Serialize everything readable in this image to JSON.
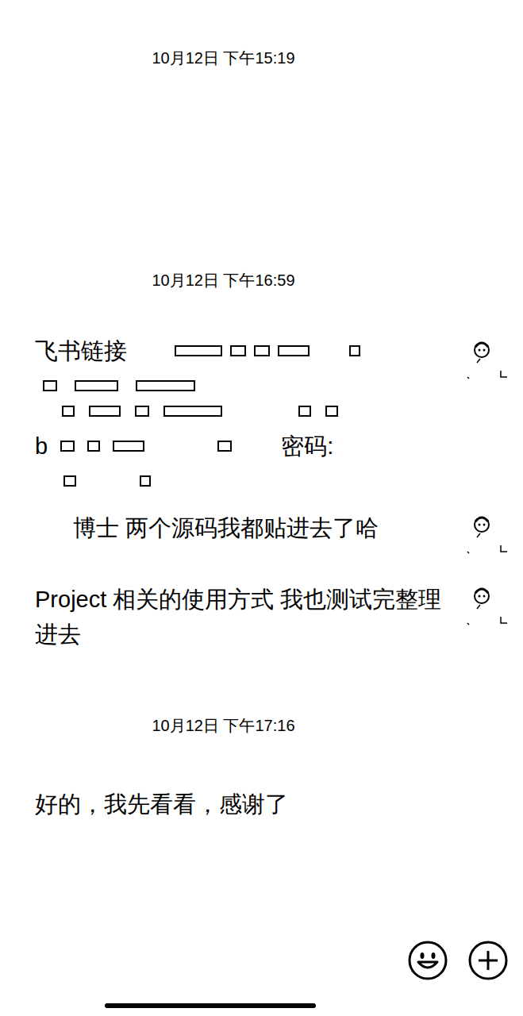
{
  "chat": {
    "items": [
      {
        "kind": "timestamp",
        "text": "10月12日 下午15:19"
      },
      {
        "kind": "blank"
      },
      {
        "kind": "timestamp",
        "text": "10月12日 下午16:59"
      },
      {
        "kind": "link",
        "label": "飞书链接",
        "prefix": "b",
        "password_label": "密码:",
        "avatar": true
      },
      {
        "kind": "text",
        "text": "博士 两个源码我都贴进去了哈",
        "avatar": true,
        "indent": true
      },
      {
        "kind": "text",
        "text": "Project 相关的使用方式 我也测试完整理进去",
        "avatar": true,
        "indent": false
      },
      {
        "kind": "timestamp",
        "text": "10月12日 下午17:16"
      },
      {
        "kind": "text",
        "text": "好的，我先看看，感谢了",
        "avatar": false,
        "indent": false
      }
    ]
  }
}
